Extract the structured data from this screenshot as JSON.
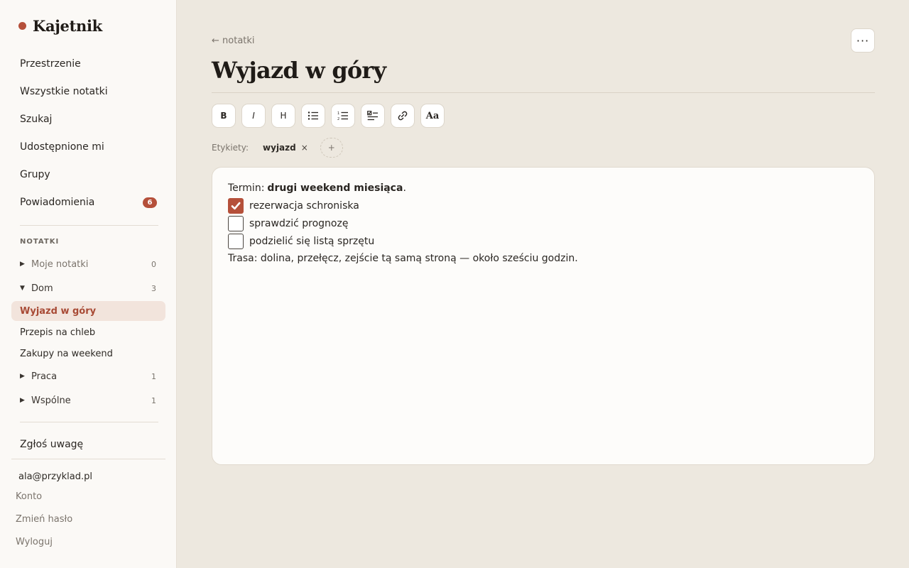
{
  "app": {
    "name": "Kajetnik",
    "accent_color": "#b5503a"
  },
  "sidebar": {
    "nav": [
      {
        "label": "Przestrzenie"
      },
      {
        "label": "Wszystkie notatki"
      },
      {
        "label": "Szukaj"
      },
      {
        "label": "Udostępnione mi"
      },
      {
        "label": "Grupy"
      },
      {
        "label": "Powiadomienia",
        "badge": "6"
      }
    ],
    "section_title": "NOTATKI",
    "tree": {
      "my_notes": {
        "label": "Moje notatki",
        "count": "0",
        "expanded": false
      },
      "home": {
        "label": "Dom",
        "count": "3",
        "expanded": true
      },
      "home_notes": [
        "Wyjazd w góry",
        "Przepis na chleb",
        "Zakupy na weekend"
      ],
      "active_note": "Wyjazd w góry",
      "work": {
        "label": "Praca",
        "count": "1",
        "expanded": false
      },
      "shared": {
        "label": "Wspólne",
        "count": "1",
        "expanded": false
      }
    },
    "feedback": "Zgłoś uwagę",
    "user": {
      "email": "ala@przyklad.pl",
      "links": [
        "Konto",
        "Zmień hasło",
        "Wyloguj"
      ]
    }
  },
  "main": {
    "back_link": "← notatki",
    "more_icon": "more-horizontal-icon",
    "more_label": "···",
    "title": "Wyjazd w góry",
    "toolbar": [
      {
        "label": "B",
        "icon": "bold-icon"
      },
      {
        "label": "I",
        "icon": "italic-icon"
      },
      {
        "label": "H",
        "icon": "heading-icon"
      },
      {
        "label": "",
        "icon": "bullet-list-icon"
      },
      {
        "label": "",
        "icon": "numbered-list-icon"
      },
      {
        "label": "",
        "icon": "checklist-icon"
      },
      {
        "label": "",
        "icon": "link-icon"
      },
      {
        "label": "Aa",
        "icon": "text-style-icon"
      }
    ],
    "tags": {
      "label": "Etykiety:",
      "items": [
        "wyjazd"
      ],
      "remove_symbol": "×",
      "add_symbol": "+"
    },
    "content": {
      "intro_prefix": "Termin:",
      "intro_bold": "drugi weekend miesiąca",
      "intro_suffix": ".",
      "checklist": [
        {
          "text": "rezerwacja schroniska",
          "checked": true
        },
        {
          "text": "sprawdzić prognozę",
          "checked": false
        },
        {
          "text": "podzielić się listą sprzętu",
          "checked": false
        }
      ],
      "route": "Trasa: dolina, przełęcz, zejście tą samą stroną — około sześciu godzin."
    }
  }
}
